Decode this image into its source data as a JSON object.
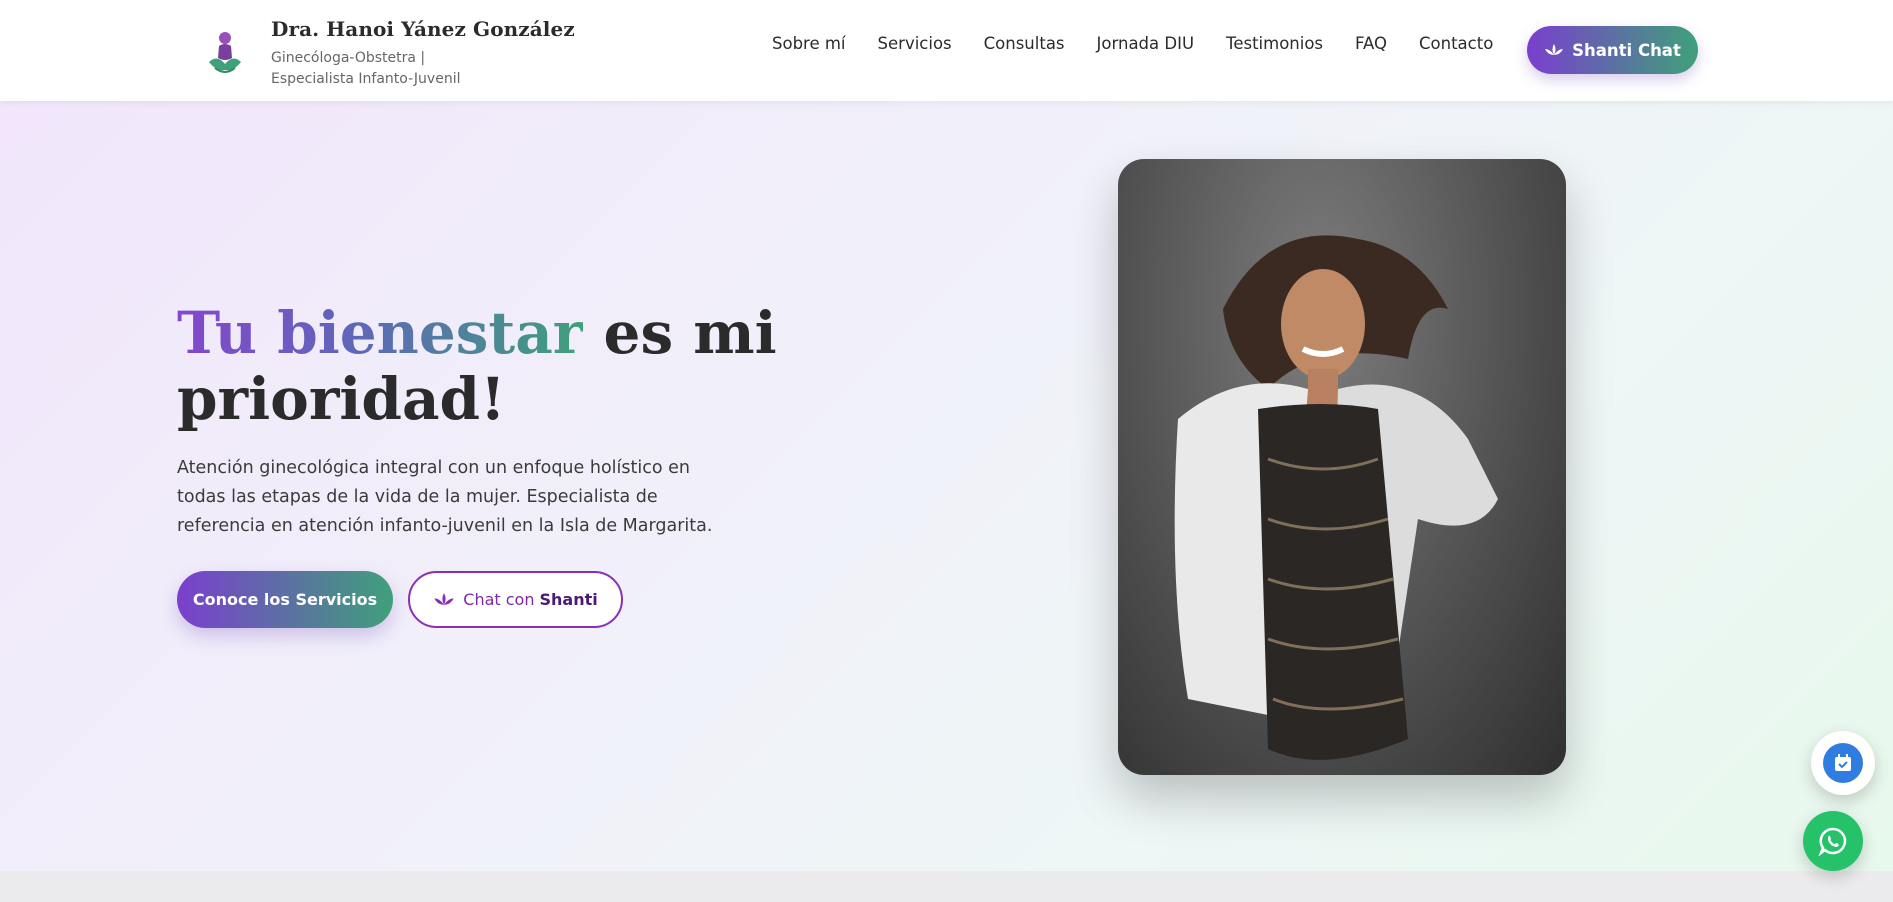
{
  "header": {
    "brand_name": "Dra. Hanoi Yánez González",
    "brand_subtitle": "Ginecóloga-Obstetra | Especialista Infanto-Juvenil",
    "nav": [
      {
        "label": "Sobre mí"
      },
      {
        "label": "Servicios"
      },
      {
        "label": "Consultas"
      },
      {
        "label": "Jornada DIU"
      },
      {
        "label": "Testimonios"
      },
      {
        "label": "FAQ"
      },
      {
        "label": "Contacto"
      }
    ],
    "chat_button": "Shanti Chat"
  },
  "hero": {
    "headline_grad": "Tu bienestar",
    "headline_rest": " es mi prioridad!",
    "lead": "Atención ginecológica integral con un enfoque holístico en todas las etapas de la vida de la mujer. Especialista de referencia en atención infanto-juvenil en la Isla de Margarita.",
    "cta_primary": "Conoce los Servicios",
    "cta_secondary_prefix": "Chat con",
    "cta_secondary_name": "Shanti"
  },
  "floating": {
    "calendar_icon": "calendar-check-icon",
    "whatsapp_icon": "whatsapp-icon"
  },
  "colors": {
    "brand_purple": "#7a3fce",
    "brand_green": "#3fa07a",
    "whatsapp": "#25c26a",
    "calendar_blue": "#2f7de1"
  }
}
